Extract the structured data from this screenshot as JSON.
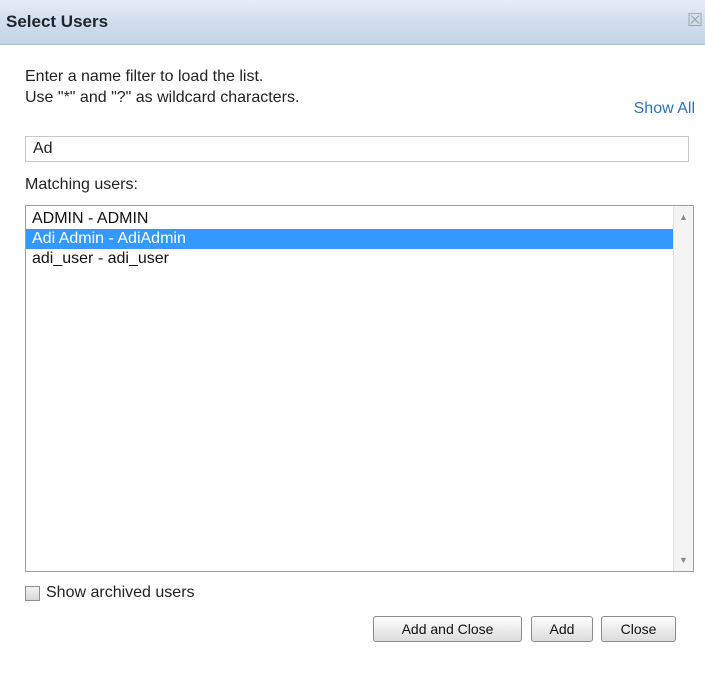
{
  "dialog": {
    "title": "Select Users",
    "close_glyph": "☒"
  },
  "instructions": {
    "line1": "Enter a name filter to load the list.",
    "line2": "Use \"*\" and \"?\" as wildcard characters."
  },
  "show_all_link": "Show All",
  "filter": {
    "value": "Ad",
    "placeholder": ""
  },
  "matching_label": "Matching users:",
  "users": [
    {
      "label": "ADMIN - ADMIN",
      "selected": false
    },
    {
      "label": "Adi Admin - AdiAdmin",
      "selected": true
    },
    {
      "label": "adi_user - adi_user",
      "selected": false
    }
  ],
  "scrollbar": {
    "up_glyph": "▲",
    "down_glyph": "▼"
  },
  "show_archived": {
    "label": "Show archived users",
    "checked": false
  },
  "buttons": {
    "add_and_close": "Add and Close",
    "add": "Add",
    "close": "Close"
  }
}
